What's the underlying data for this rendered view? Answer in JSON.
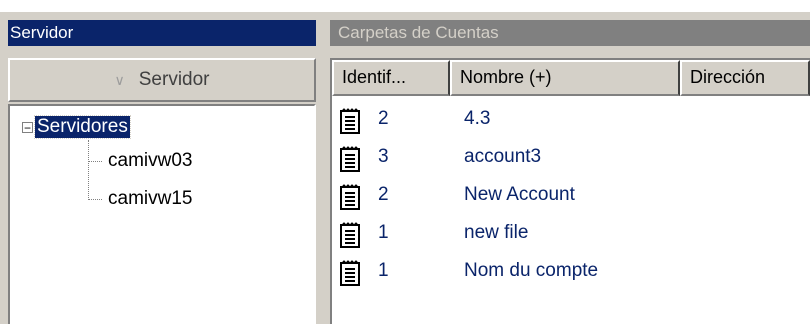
{
  "left_panel": {
    "title": "Servidor",
    "column_header": "Servidor",
    "column_header_icon": "chevron-down-icon",
    "tree": {
      "root": {
        "label": "Servidores",
        "expander": "−",
        "selected": true
      },
      "children": [
        {
          "label": "camivw03"
        },
        {
          "label": "camivw15"
        }
      ]
    }
  },
  "right_panel": {
    "title": "Carpetas de Cuentas",
    "columns": [
      "Identif...",
      "Nombre (+)",
      "Dirección"
    ],
    "rows": [
      {
        "icon": "document-icon",
        "id": "2",
        "name": "4.3"
      },
      {
        "icon": "document-icon",
        "id": "3",
        "name": "account3"
      },
      {
        "icon": "document-icon",
        "id": "2",
        "name": "New Account"
      },
      {
        "icon": "document-icon",
        "id": "1",
        "name": "new file"
      },
      {
        "icon": "document-icon",
        "id": "1",
        "name": "Nom du compte"
      }
    ]
  },
  "colors": {
    "selection": "#0a246a",
    "window_bg": "#d4d0c8",
    "inactive_title": "#808080",
    "text_link": "#0a246a"
  }
}
